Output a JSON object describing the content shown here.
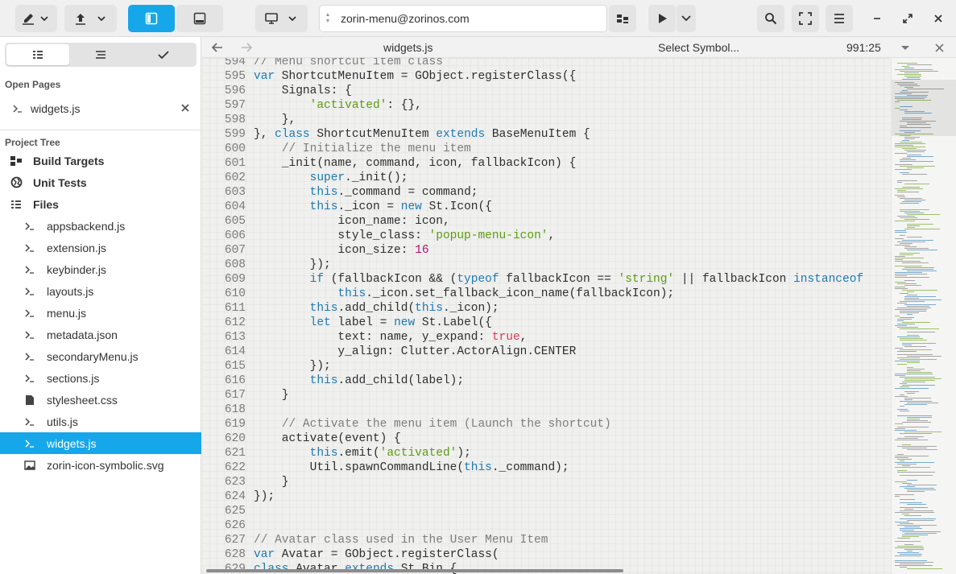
{
  "address": {
    "value": "zorin-menu@zorinos.com"
  },
  "sidebar": {
    "open_pages_title": "Open Pages",
    "open_page": "widgets.js",
    "project_tree_title": "Project Tree",
    "top_items": [
      "Build Targets",
      "Unit Tests",
      "Files"
    ],
    "files": [
      "appsbackend.js",
      "extension.js",
      "keybinder.js",
      "layouts.js",
      "menu.js",
      "metadata.json",
      "secondaryMenu.js",
      "sections.js",
      "stylesheet.css",
      "utils.js",
      "widgets.js",
      "zorin-icon-symbolic.svg"
    ],
    "selected_file": "widgets.js"
  },
  "editor": {
    "filename": "widgets.js",
    "symbol_selector": "Select Symbol...",
    "position": "991:25",
    "lines": [
      [
        594,
        "// Menu shortcut item class"
      ],
      [
        595,
        "var ShortcutMenuItem = GObject.registerClass({"
      ],
      [
        596,
        "    Signals: {"
      ],
      [
        597,
        "        'activated': {},"
      ],
      [
        598,
        "    },"
      ],
      [
        599,
        "}, class ShortcutMenuItem extends BaseMenuItem {"
      ],
      [
        600,
        "    // Initialize the menu item"
      ],
      [
        601,
        "    _init(name, command, icon, fallbackIcon) {"
      ],
      [
        602,
        "        super._init();"
      ],
      [
        603,
        "        this._command = command;"
      ],
      [
        604,
        "        this._icon = new St.Icon({"
      ],
      [
        605,
        "            icon_name: icon,"
      ],
      [
        606,
        "            style_class: 'popup-menu-icon',"
      ],
      [
        607,
        "            icon_size: 16"
      ],
      [
        608,
        "        });"
      ],
      [
        609,
        "        if (fallbackIcon && (typeof fallbackIcon == 'string' || fallbackIcon instanceof"
      ],
      [
        610,
        "            this._icon.set_fallback_icon_name(fallbackIcon);"
      ],
      [
        611,
        "        this.add_child(this._icon);"
      ],
      [
        612,
        "        let label = new St.Label({"
      ],
      [
        613,
        "            text: name, y_expand: true,"
      ],
      [
        614,
        "            y_align: Clutter.ActorAlign.CENTER"
      ],
      [
        615,
        "        });"
      ],
      [
        616,
        "        this.add_child(label);"
      ],
      [
        617,
        "    }"
      ],
      [
        618,
        ""
      ],
      [
        619,
        "    // Activate the menu item (Launch the shortcut)"
      ],
      [
        620,
        "    activate(event) {"
      ],
      [
        621,
        "        this.emit('activated');"
      ],
      [
        622,
        "        Util.spawnCommandLine(this._command);"
      ],
      [
        623,
        "    }"
      ],
      [
        624,
        "});"
      ],
      [
        625,
        ""
      ],
      [
        626,
        ""
      ],
      [
        627,
        "// Avatar class used in the User Menu Item"
      ],
      [
        628,
        "var Avatar = GObject.registerClass("
      ],
      [
        629,
        "class Avatar extends St.Bin {"
      ]
    ]
  },
  "colors": {
    "accent": "#16a7ea",
    "keyword": "#1d79b0",
    "string": "#5c9b0d",
    "number": "#b8126d",
    "boolean": "#e0384f",
    "comment": "#7d7d7d"
  }
}
